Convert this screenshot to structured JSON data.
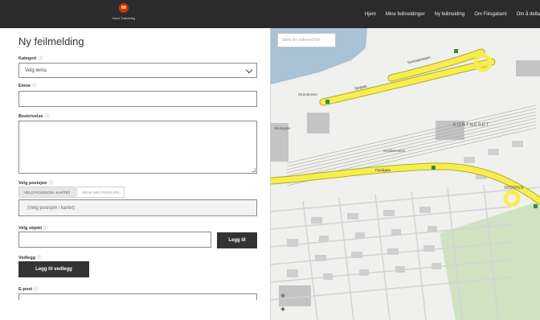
{
  "header": {
    "logo_text": "Nord-Trøndelag",
    "nav": [
      "Hjem",
      "Mine feilmeldinger",
      "Ny feilmelding",
      "Om Fiksgatami",
      "Om å delta"
    ]
  },
  "form": {
    "title": "Ny feilmelding",
    "kategori": {
      "label": "Kategori",
      "value": "Velg tema"
    },
    "emne": {
      "label": "Emne",
      "value": ""
    },
    "beskrivelse": {
      "label": "Beskrivelse",
      "value": ""
    },
    "posisjon": {
      "label": "Velg posisjon",
      "tabs": [
        "VELG POSISJON I KARTET",
        "BRUK MIN POSISJON"
      ],
      "value": "(Velg posisjon i kartet)"
    },
    "referanse": {
      "label": "Velg objekt",
      "button": "Legg til"
    },
    "vedlegg": {
      "label": "Vedlegg",
      "button": "Legg til vedlegg"
    },
    "epost": {
      "label": "E-post"
    }
  },
  "map": {
    "search_placeholder": "Skriv inn søkeord her",
    "labels": [
      "Nonstadvegen",
      "Fjordgata",
      "KORTNESET",
      "SKOPPEN",
      "Sjøgata",
      "Strandveien",
      "Skolegata",
      "Snekkerveien"
    ],
    "locate_icon": "⊕",
    "zoom_in": "+",
    "colors": {
      "road": "#f7ee4f",
      "road_stroke": "#b3a92a",
      "water": "#a9c2d4",
      "park": "#cfe3c2"
    }
  }
}
